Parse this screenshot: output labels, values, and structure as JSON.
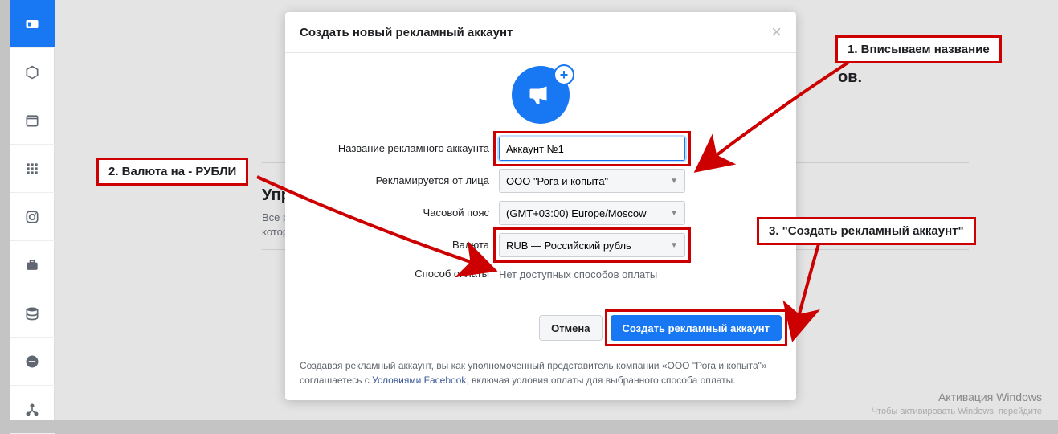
{
  "sidebar": {
    "items": [
      {
        "name": "badge-icon"
      },
      {
        "name": "cube-icon"
      },
      {
        "name": "calendar-icon"
      },
      {
        "name": "grid-icon"
      },
      {
        "name": "instagram-icon"
      },
      {
        "name": "briefcase-icon"
      },
      {
        "name": "stack-icon"
      },
      {
        "name": "minus-circle-icon"
      },
      {
        "name": "org-icon"
      }
    ]
  },
  "page": {
    "heading_right_fragment": "ов.",
    "section_heading": "Управление",
    "section_desc": "Все рекламные которым нужен"
  },
  "modal": {
    "title": "Создать новый рекламный аккаунт",
    "fields": {
      "name_label": "Название рекламного аккаунта",
      "name_value": "Аккаунт №1",
      "advertiser_label": "Рекламируется от лица",
      "advertiser_value": "ООО \"Рога и копыта\"",
      "timezone_label": "Часовой пояс",
      "timezone_value": "(GMT+03:00) Europe/Moscow",
      "currency_label": "Валюта",
      "currency_value": "RUB — Российский рубль",
      "payment_label": "Способ оплаты",
      "payment_value": "Нет доступных способов оплаты"
    },
    "footer": {
      "cancel": "Отмена",
      "submit": "Создать рекламный аккаунт"
    },
    "legal_pre": "Создавая рекламный аккаунт, вы как уполномоченный представитель компании «ООО \"Рога и копыта\"» соглашаетесь с ",
    "legal_link": "Условиями Facebook",
    "legal_post": ", включая условия оплаты для выбранного способа оплаты."
  },
  "callouts": {
    "c1": "1. Вписываем название",
    "c2": "2. Валюта на - РУБЛИ",
    "c3": "3. \"Создать рекламный аккаунт\""
  },
  "watermark": {
    "line1": "Активация Windows",
    "line2": "Чтобы активировать Windows, перейдите"
  },
  "colors": {
    "accent": "#1877f2",
    "annotation": "#c00"
  }
}
